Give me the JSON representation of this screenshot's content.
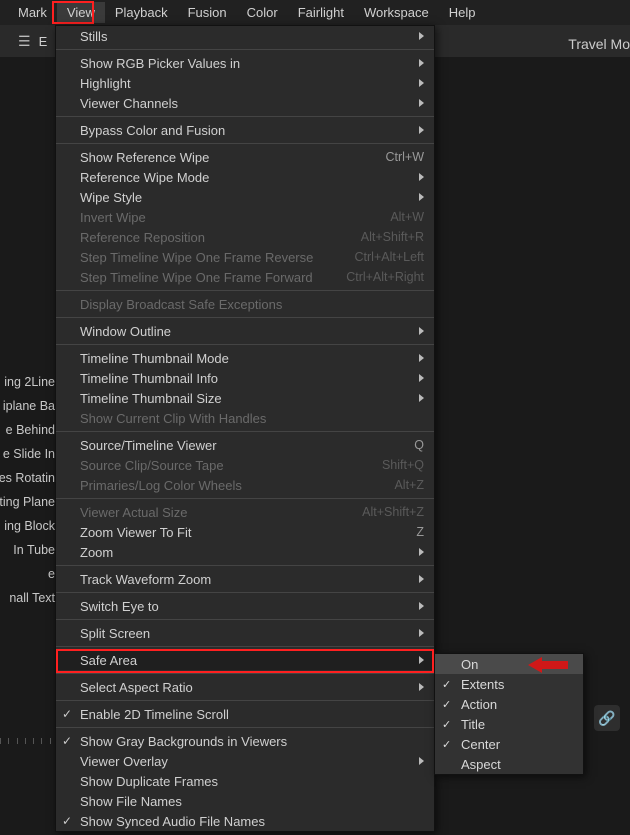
{
  "menubar": {
    "items": [
      {
        "label": "Mark"
      },
      {
        "label": "View"
      },
      {
        "label": "Playback"
      },
      {
        "label": "Fusion"
      },
      {
        "label": "Color"
      },
      {
        "label": "Fairlight"
      },
      {
        "label": "Workspace"
      },
      {
        "label": "Help"
      }
    ],
    "active_index": 1
  },
  "toolbar": {
    "edit_fragment": "E"
  },
  "title_fragment": "Travel Mo",
  "background_labels": [
    "ing 2Line",
    "iplane Ba",
    "e Behind",
    "e Slide In",
    "es Rotatin",
    "ting Plane",
    "",
    "ing Block",
    "In Tube",
    "e",
    "nall Text",
    ""
  ],
  "dropdown": [
    {
      "label": "Stills",
      "submenu": true
    },
    {
      "sep": true
    },
    {
      "label": "Show RGB Picker Values in",
      "submenu": true
    },
    {
      "label": "Highlight",
      "submenu": true
    },
    {
      "label": "Viewer Channels",
      "submenu": true
    },
    {
      "sep": true
    },
    {
      "label": "Bypass Color and Fusion",
      "submenu": true
    },
    {
      "sep": true
    },
    {
      "label": "Show Reference Wipe",
      "shortcut": "Ctrl+W"
    },
    {
      "label": "Reference Wipe Mode",
      "submenu": true
    },
    {
      "label": "Wipe Style",
      "submenu": true
    },
    {
      "label": "Invert Wipe",
      "shortcut": "Alt+W",
      "disabled": true
    },
    {
      "label": "Reference Reposition",
      "shortcut": "Alt+Shift+R",
      "disabled": true
    },
    {
      "label": "Step Timeline Wipe One Frame Reverse",
      "shortcut": "Ctrl+Alt+Left",
      "disabled": true
    },
    {
      "label": "Step Timeline Wipe One Frame Forward",
      "shortcut": "Ctrl+Alt+Right",
      "disabled": true
    },
    {
      "sep": true
    },
    {
      "label": "Display Broadcast Safe Exceptions",
      "disabled": true
    },
    {
      "sep": true
    },
    {
      "label": "Window Outline",
      "submenu": true
    },
    {
      "sep": true
    },
    {
      "label": "Timeline Thumbnail Mode",
      "submenu": true
    },
    {
      "label": "Timeline Thumbnail Info",
      "submenu": true
    },
    {
      "label": "Timeline Thumbnail Size",
      "submenu": true
    },
    {
      "label": "Show Current Clip With Handles",
      "disabled": true
    },
    {
      "sep": true
    },
    {
      "label": "Source/Timeline Viewer",
      "shortcut": "Q"
    },
    {
      "label": "Source Clip/Source Tape",
      "shortcut": "Shift+Q",
      "disabled": true
    },
    {
      "label": "Primaries/Log Color Wheels",
      "shortcut": "Alt+Z",
      "disabled": true
    },
    {
      "sep": true
    },
    {
      "label": "Viewer Actual Size",
      "shortcut": "Alt+Shift+Z",
      "disabled": true
    },
    {
      "label": "Zoom Viewer To Fit",
      "shortcut": "Z"
    },
    {
      "label": "Zoom",
      "submenu": true
    },
    {
      "sep": true
    },
    {
      "label": "Track Waveform Zoom",
      "submenu": true
    },
    {
      "sep": true
    },
    {
      "label": "Switch Eye to",
      "submenu": true
    },
    {
      "sep": true
    },
    {
      "label": "Split Screen",
      "submenu": true
    },
    {
      "sep": true
    },
    {
      "label": "Safe Area",
      "submenu": true,
      "highlight": true
    },
    {
      "sep": true
    },
    {
      "label": "Select Aspect Ratio",
      "submenu": true
    },
    {
      "sep": true
    },
    {
      "label": "Enable 2D Timeline Scroll",
      "checked": true
    },
    {
      "sep": true
    },
    {
      "label": "Show Gray Backgrounds in Viewers",
      "checked": true
    },
    {
      "label": "Viewer Overlay",
      "submenu": true
    },
    {
      "label": "Show Duplicate Frames"
    },
    {
      "label": "Show File Names"
    },
    {
      "label": "Show Synced Audio File Names",
      "checked": true
    }
  ],
  "submenu": {
    "items": [
      {
        "label": "On",
        "hover": true
      },
      {
        "label": "Extents",
        "checked": true
      },
      {
        "label": "Action",
        "checked": true
      },
      {
        "label": "Title",
        "checked": true
      },
      {
        "label": "Center",
        "checked": true
      },
      {
        "label": "Aspect"
      }
    ]
  },
  "annotations": {
    "view_highlight_color": "#ff2020",
    "safearea_highlight_color": "#ff2020",
    "arrow_color": "#d01818"
  }
}
